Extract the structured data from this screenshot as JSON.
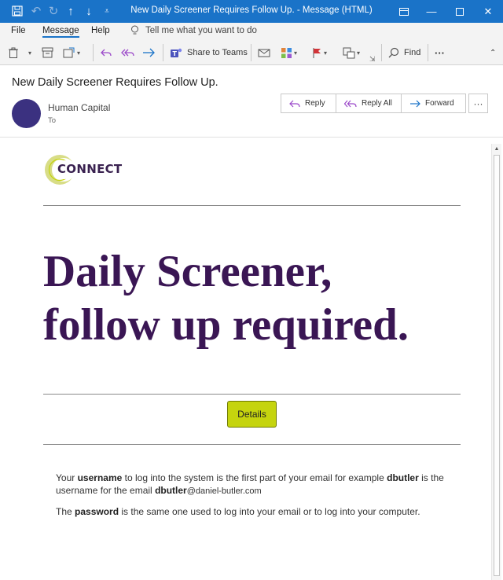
{
  "window": {
    "title": "New Daily Screener Requires Follow Up.  -  Message (HTML)"
  },
  "menu": {
    "tabs": [
      "File",
      "Message",
      "Help"
    ],
    "tell_me": "Tell me what you want to do"
  },
  "ribbon": {
    "share_to_teams": "Share to Teams",
    "find": "Find",
    "more": "···"
  },
  "message": {
    "subject": "New Daily Screener Requires Follow Up.",
    "sender": "Human Capital",
    "to_label": "To",
    "actions": {
      "reply": "Reply",
      "reply_all": "Reply All",
      "forward": "Forward",
      "more": "···"
    }
  },
  "email_body": {
    "logo_text": "CONNECT",
    "headline_line1": "Daily Screener,",
    "headline_line2": "follow up required.",
    "button_label": "Details",
    "p1_a": "Your ",
    "p1_b": "username",
    "p1_c": " to log into the system is the first part of your email for example ",
    "p1_d": "dbutler",
    "p1_e": " is the username for the email ",
    "p1_f": "dbutler",
    "p1_g": "@daniel-butler.com",
    "p2_a": "The ",
    "p2_b": "password",
    "p2_c": " is the same one used to log into your email or to log into your computer."
  },
  "colors": {
    "titlebar": "#1a73c8",
    "avatar": "#3b3180",
    "headline": "#3a1654",
    "button": "#c5d40e"
  }
}
